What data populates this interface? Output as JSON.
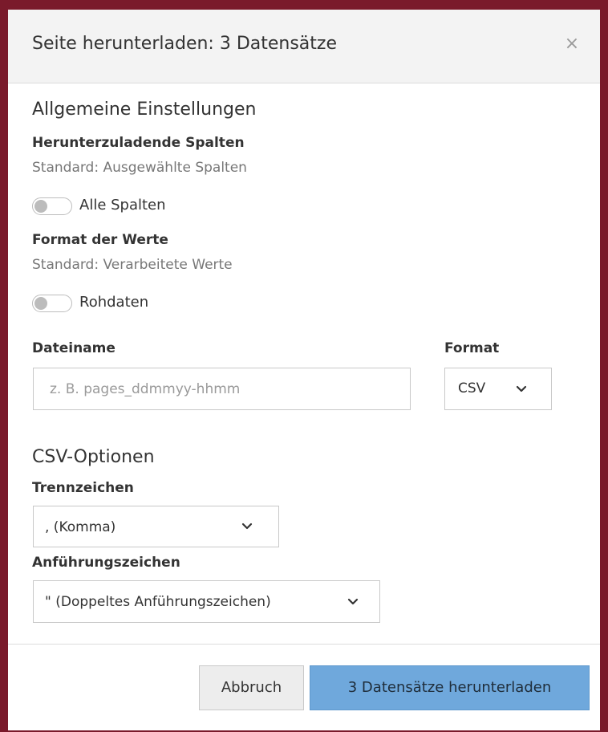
{
  "dialog": {
    "title": "Seite herunterladen: 3 Datensätze",
    "close_label": "×"
  },
  "general": {
    "heading": "Allgemeine Einstellungen",
    "columns_label": "Herunterzuladende Spalten",
    "columns_help": "Standard: Ausgewählte Spalten",
    "all_columns_toggle_label": "Alle Spalten",
    "all_columns_toggle_on": false,
    "values_label": "Format der Werte",
    "values_help": "Standard: Verarbeitete Werte",
    "raw_toggle_label": "Rohdaten",
    "raw_toggle_on": false
  },
  "file": {
    "filename_label": "Dateiname",
    "filename_value": "",
    "filename_placeholder": "z. B. pages_ddmmyy-hhmm",
    "format_label": "Format",
    "format_value": "CSV"
  },
  "csv": {
    "heading": "CSV-Optionen",
    "delimiter_label": "Trennzeichen",
    "delimiter_value": ", (Komma)",
    "quote_label": "Anführungszeichen",
    "quote_value": "\" (Doppeltes Anführungszeichen)"
  },
  "footer": {
    "cancel_label": "Abbruch",
    "download_label": "3 Datensätze herunterladen"
  },
  "colors": {
    "backdrop": "#7a1a2b",
    "primary_button": "#6fa8dc"
  }
}
